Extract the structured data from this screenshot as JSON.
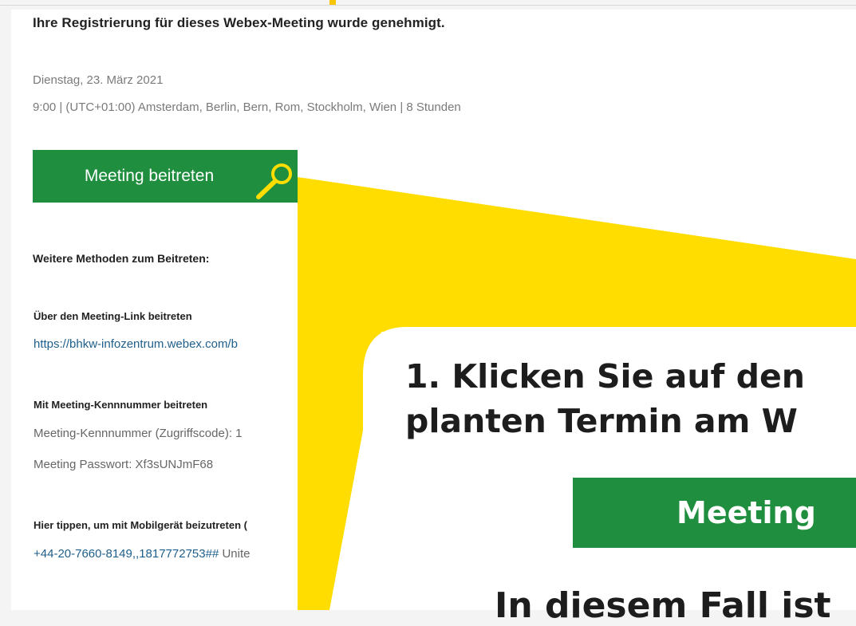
{
  "email": {
    "heading": "Ihre Registrierung für dieses Webex-Meeting wurde genehmigt.",
    "date": "Dienstag, 23. März 2021",
    "time_info": "9:00  |  (UTC+01:00) Amsterdam, Berlin, Bern, Rom, Stockholm, Wien  |  8 Stunden",
    "join_button": "Meeting beitreten",
    "more_methods": "Weitere Methoden zum Beitreten:",
    "link_section": {
      "title": "Über den Meeting-Link beitreten",
      "url": "https://bhkw-infozentrum.webex.com/b"
    },
    "number_section": {
      "title": "Mit Meeting-Kennnummer beitreten",
      "number_line": "Meeting-Kennnummer (Zugriffscode): 1",
      "password_line": "Meeting Passwort: Xf3sUNJmF68"
    },
    "mobile_section": {
      "title": "Hier tippen, um mit Mobilgerät beizutreten (",
      "number": "+44-20-7660-8149,,1817772753##",
      "country": " Unite"
    }
  },
  "callout": {
    "line1": "1. Klicken Sie auf den",
    "line2": "planten Termin am W",
    "button_label": "Meeting",
    "bottom_text": "In diesem Fall ist"
  },
  "colors": {
    "accent_green": "#1f8f3f",
    "callout_yellow": "#ffdd00",
    "link_blue": "#1f5f8b"
  }
}
